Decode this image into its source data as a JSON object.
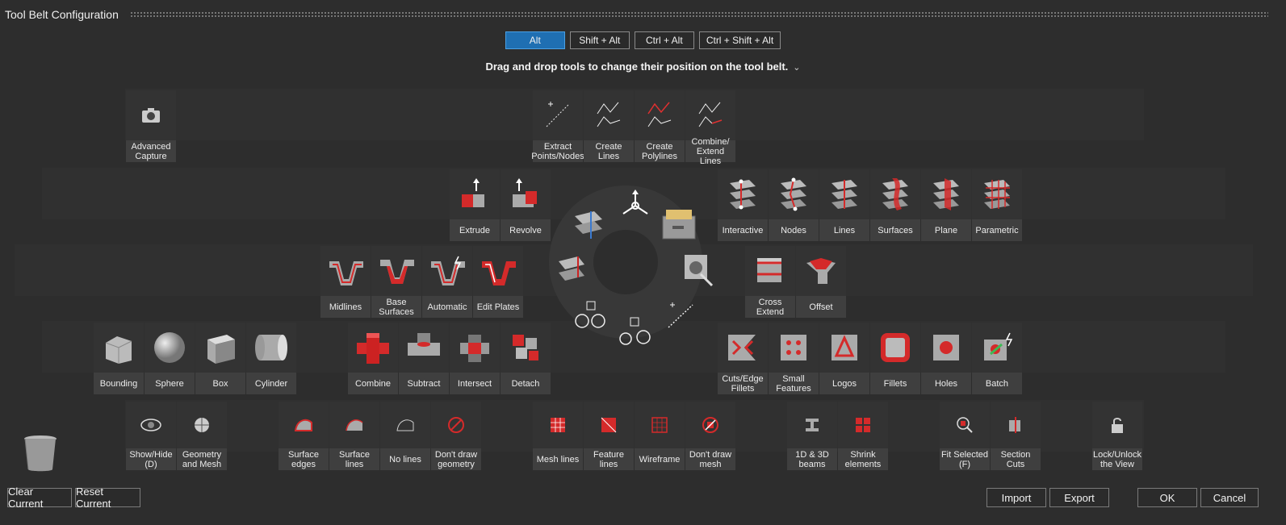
{
  "window": {
    "title": "Tool Belt Configuration"
  },
  "modifiers": [
    {
      "label": "Alt",
      "active": true
    },
    {
      "label": "Shift + Alt",
      "active": false
    },
    {
      "label": "Ctrl + Alt",
      "active": false
    },
    {
      "label": "Ctrl + Shift + Alt",
      "active": false
    }
  ],
  "hint": "Drag and drop tools to change their position on the tool belt.",
  "row1": [
    "Advanced Capture",
    "Extract Points/Nodes",
    "Create Lines",
    "Create Polylines",
    "Combine/ Extend Lines"
  ],
  "row2": [
    "Extrude",
    "Revolve",
    "Interactive",
    "Nodes",
    "Lines",
    "Surfaces",
    "Plane",
    "Parametric"
  ],
  "row3": [
    "Midlines",
    "Base Surfaces",
    "Automatic",
    "Edit Plates",
    "Cross Extend",
    "Offset"
  ],
  "row4": [
    "Bounding",
    "Sphere",
    "Box",
    "Cylinder",
    "Combine",
    "Subtract",
    "Intersect",
    "Detach",
    "Cuts/Edge Fillets",
    "Small Features",
    "Logos",
    "Fillets",
    "Holes",
    "Batch"
  ],
  "row5": [
    "Show/Hide (D)",
    "Geometry and Mesh",
    "Surface edges",
    "Surface lines",
    "No lines",
    "Don't draw geometry",
    "Mesh lines",
    "Feature lines",
    "Wireframe",
    "Don't draw mesh",
    "1D & 3D beams",
    "Shrink elements",
    "Fit Selected (F)",
    "Section Cuts",
    "Lock/Unlock the View"
  ],
  "footer": {
    "clear": "Clear Current",
    "reset": "Reset Current",
    "import": "Import",
    "export": "Export",
    "ok": "OK",
    "cancel": "Cancel"
  },
  "colors": {
    "accent": "#1f6fb2",
    "tool_red": "#d42a2a",
    "tool_gray": "#a8a8a8"
  }
}
